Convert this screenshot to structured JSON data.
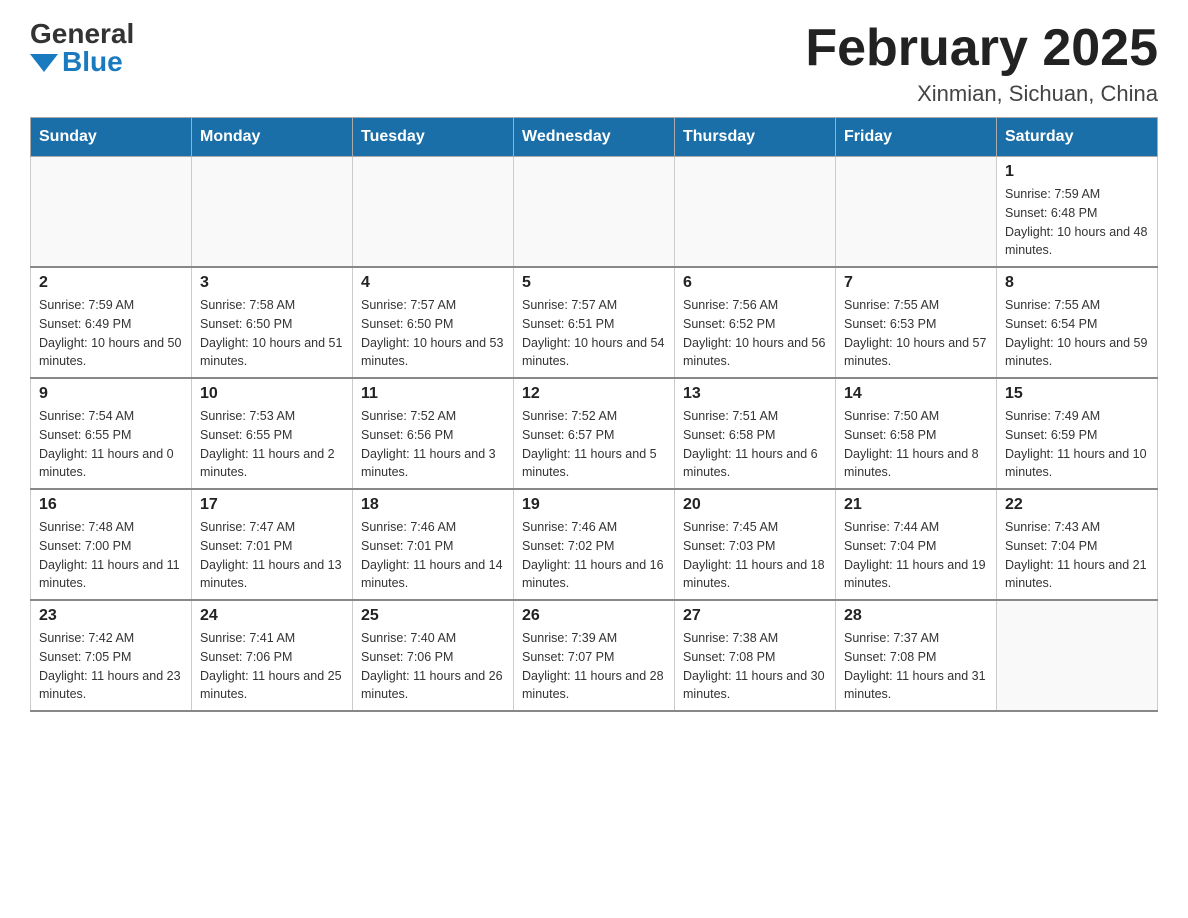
{
  "logo": {
    "general": "General",
    "blue": "Blue"
  },
  "title": "February 2025",
  "subtitle": "Xinmian, Sichuan, China",
  "days_of_week": [
    "Sunday",
    "Monday",
    "Tuesday",
    "Wednesday",
    "Thursday",
    "Friday",
    "Saturday"
  ],
  "weeks": [
    [
      {
        "day": "",
        "info": ""
      },
      {
        "day": "",
        "info": ""
      },
      {
        "day": "",
        "info": ""
      },
      {
        "day": "",
        "info": ""
      },
      {
        "day": "",
        "info": ""
      },
      {
        "day": "",
        "info": ""
      },
      {
        "day": "1",
        "info": "Sunrise: 7:59 AM\nSunset: 6:48 PM\nDaylight: 10 hours and 48 minutes."
      }
    ],
    [
      {
        "day": "2",
        "info": "Sunrise: 7:59 AM\nSunset: 6:49 PM\nDaylight: 10 hours and 50 minutes."
      },
      {
        "day": "3",
        "info": "Sunrise: 7:58 AM\nSunset: 6:50 PM\nDaylight: 10 hours and 51 minutes."
      },
      {
        "day": "4",
        "info": "Sunrise: 7:57 AM\nSunset: 6:50 PM\nDaylight: 10 hours and 53 minutes."
      },
      {
        "day": "5",
        "info": "Sunrise: 7:57 AM\nSunset: 6:51 PM\nDaylight: 10 hours and 54 minutes."
      },
      {
        "day": "6",
        "info": "Sunrise: 7:56 AM\nSunset: 6:52 PM\nDaylight: 10 hours and 56 minutes."
      },
      {
        "day": "7",
        "info": "Sunrise: 7:55 AM\nSunset: 6:53 PM\nDaylight: 10 hours and 57 minutes."
      },
      {
        "day": "8",
        "info": "Sunrise: 7:55 AM\nSunset: 6:54 PM\nDaylight: 10 hours and 59 minutes."
      }
    ],
    [
      {
        "day": "9",
        "info": "Sunrise: 7:54 AM\nSunset: 6:55 PM\nDaylight: 11 hours and 0 minutes."
      },
      {
        "day": "10",
        "info": "Sunrise: 7:53 AM\nSunset: 6:55 PM\nDaylight: 11 hours and 2 minutes."
      },
      {
        "day": "11",
        "info": "Sunrise: 7:52 AM\nSunset: 6:56 PM\nDaylight: 11 hours and 3 minutes."
      },
      {
        "day": "12",
        "info": "Sunrise: 7:52 AM\nSunset: 6:57 PM\nDaylight: 11 hours and 5 minutes."
      },
      {
        "day": "13",
        "info": "Sunrise: 7:51 AM\nSunset: 6:58 PM\nDaylight: 11 hours and 6 minutes."
      },
      {
        "day": "14",
        "info": "Sunrise: 7:50 AM\nSunset: 6:58 PM\nDaylight: 11 hours and 8 minutes."
      },
      {
        "day": "15",
        "info": "Sunrise: 7:49 AM\nSunset: 6:59 PM\nDaylight: 11 hours and 10 minutes."
      }
    ],
    [
      {
        "day": "16",
        "info": "Sunrise: 7:48 AM\nSunset: 7:00 PM\nDaylight: 11 hours and 11 minutes."
      },
      {
        "day": "17",
        "info": "Sunrise: 7:47 AM\nSunset: 7:01 PM\nDaylight: 11 hours and 13 minutes."
      },
      {
        "day": "18",
        "info": "Sunrise: 7:46 AM\nSunset: 7:01 PM\nDaylight: 11 hours and 14 minutes."
      },
      {
        "day": "19",
        "info": "Sunrise: 7:46 AM\nSunset: 7:02 PM\nDaylight: 11 hours and 16 minutes."
      },
      {
        "day": "20",
        "info": "Sunrise: 7:45 AM\nSunset: 7:03 PM\nDaylight: 11 hours and 18 minutes."
      },
      {
        "day": "21",
        "info": "Sunrise: 7:44 AM\nSunset: 7:04 PM\nDaylight: 11 hours and 19 minutes."
      },
      {
        "day": "22",
        "info": "Sunrise: 7:43 AM\nSunset: 7:04 PM\nDaylight: 11 hours and 21 minutes."
      }
    ],
    [
      {
        "day": "23",
        "info": "Sunrise: 7:42 AM\nSunset: 7:05 PM\nDaylight: 11 hours and 23 minutes."
      },
      {
        "day": "24",
        "info": "Sunrise: 7:41 AM\nSunset: 7:06 PM\nDaylight: 11 hours and 25 minutes."
      },
      {
        "day": "25",
        "info": "Sunrise: 7:40 AM\nSunset: 7:06 PM\nDaylight: 11 hours and 26 minutes."
      },
      {
        "day": "26",
        "info": "Sunrise: 7:39 AM\nSunset: 7:07 PM\nDaylight: 11 hours and 28 minutes."
      },
      {
        "day": "27",
        "info": "Sunrise: 7:38 AM\nSunset: 7:08 PM\nDaylight: 11 hours and 30 minutes."
      },
      {
        "day": "28",
        "info": "Sunrise: 7:37 AM\nSunset: 7:08 PM\nDaylight: 11 hours and 31 minutes."
      },
      {
        "day": "",
        "info": ""
      }
    ]
  ]
}
